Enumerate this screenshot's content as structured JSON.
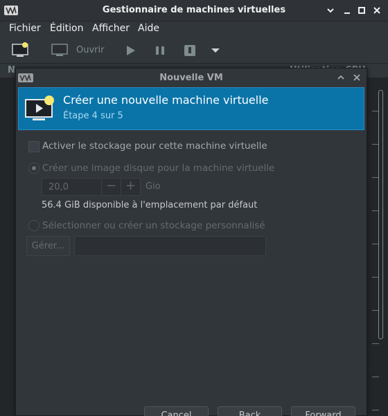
{
  "window": {
    "title": "Gestionnaire de machines virtuelles",
    "menu": [
      "Fichier",
      "Édition",
      "Afficher",
      "Aide"
    ],
    "toolbar": {
      "open_label": "Ouvrir"
    },
    "list_header": {
      "col1": "N",
      "col2": "Utilisation CPU"
    }
  },
  "dialog": {
    "title": "Nouvelle VM",
    "header_title": "Créer une nouvelle machine virtuelle",
    "step": "Étape 4 sur 5",
    "enable_storage_label": "Activer le stockage pour cette machine virtuelle",
    "create_disk_label": "Créer une image disque pour la machine virtuelle",
    "disk_size_value": "20,0",
    "disk_unit": "Gio",
    "available_text": "56.4 GiB disponible à l'emplacement par défaut",
    "custom_storage_label": "Sélectionner ou créer un stockage personnalisé",
    "manage_button": "Gérer...",
    "custom_path_value": "",
    "buttons": {
      "cancel": "Cancel",
      "back": "Back",
      "forward": "Forward"
    }
  },
  "colors": {
    "accent": "#0a74a8",
    "background": "#31363b"
  }
}
